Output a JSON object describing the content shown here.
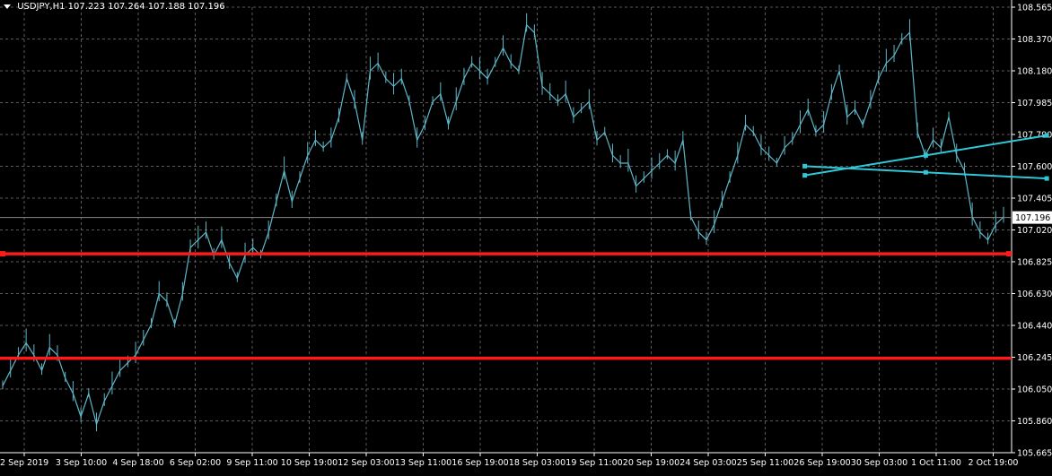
{
  "window": {
    "symbol": "USDJPY,H1",
    "ohlc": "107.223 107.264 107.188 107.196"
  },
  "colors": {
    "background": "#000000",
    "grid": "#5a5a5a",
    "candles": "#5fb6c8",
    "support_lines": "#ff1a1a",
    "trendlines": "#2ec8d8",
    "text": "#ffffff"
  },
  "chart_data": {
    "type": "line",
    "xlabel": "",
    "ylabel": "",
    "grid": true,
    "ylim": [
      105.665,
      108.565
    ],
    "y_ticks": [
      "108.565",
      "108.370",
      "108.180",
      "107.985",
      "107.790",
      "107.600",
      "107.405",
      "107.020",
      "106.825",
      "106.630",
      "106.440",
      "106.245",
      "106.050",
      "105.860",
      "105.665"
    ],
    "x_ticks": [
      "2 Sep 2019",
      "3 Sep 10:00",
      "4 Sep 18:00",
      "6 Sep 02:00",
      "9 Sep 11:00",
      "10 Sep 19:00",
      "12 Sep 03:00",
      "13 Sep 11:00",
      "16 Sep 19:00",
      "18 Sep 03:00",
      "19 Sep 11:00",
      "20 Sep 19:00",
      "24 Sep 03:00",
      "25 Sep 11:00",
      "26 Sep 19:00",
      "30 Sep 03:00",
      "1 Oct 11:00",
      "2 Oct 19:00"
    ],
    "current_price": "107.196",
    "horizontal_levels": [
      106.96,
      106.28
    ],
    "series": [
      {
        "values": [
          106.1,
          106.2,
          106.3,
          106.38,
          106.3,
          106.2,
          106.35,
          106.3,
          106.15,
          106.05,
          105.9,
          106.05,
          105.85,
          106.0,
          106.1,
          106.2,
          106.25,
          106.3,
          106.4,
          106.5,
          106.7,
          106.65,
          106.5,
          106.7,
          107.0,
          107.05,
          107.1,
          106.95,
          107.05,
          106.9,
          106.8,
          106.95,
          107.0,
          106.95,
          107.1,
          107.3,
          107.5,
          107.3,
          107.45,
          107.6,
          107.7,
          107.65,
          107.7,
          107.85,
          108.1,
          107.95,
          107.7,
          108.15,
          108.2,
          108.1,
          108.05,
          108.1,
          107.95,
          107.7,
          107.8,
          107.95,
          108.0,
          107.8,
          107.95,
          108.1,
          108.2,
          108.15,
          108.1,
          108.2,
          108.3,
          108.2,
          108.15,
          108.45,
          108.4,
          108.05,
          108.0,
          107.95,
          108.0,
          107.85,
          107.9,
          107.95,
          107.7,
          107.75,
          107.6,
          107.55,
          107.55,
          107.4,
          107.45,
          107.5,
          107.55,
          107.6,
          107.55,
          107.7,
          107.2,
          107.1,
          107.05,
          107.15,
          107.3,
          107.45,
          107.6,
          107.8,
          107.75,
          107.65,
          107.6,
          107.55,
          107.65,
          107.7,
          107.8,
          107.9,
          107.75,
          107.8,
          108.0,
          108.15,
          107.85,
          107.9,
          107.8,
          107.95,
          108.1,
          108.2,
          108.25,
          108.35,
          108.4,
          107.75,
          107.6,
          107.7,
          107.65,
          107.85,
          107.6,
          107.5,
          107.2,
          107.1,
          107.05,
          107.15,
          107.2
        ]
      }
    ],
    "trendlines": [
      {
        "from": [
          0.765,
          107.47
        ],
        "to": [
          0.995,
          107.73
        ]
      },
      {
        "from": [
          0.765,
          107.53
        ],
        "to": [
          0.995,
          107.45
        ]
      }
    ]
  }
}
